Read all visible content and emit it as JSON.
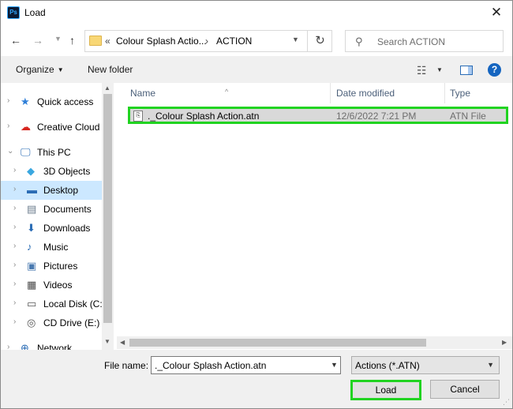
{
  "window": {
    "title": "Load",
    "app_icon_text": "Ps"
  },
  "navigation": {
    "back_icon": "arrow-left-icon",
    "forward_icon": "arrow-right-icon",
    "recent_icon": "chevron-down-icon",
    "up_icon": "arrow-up-icon",
    "address": {
      "overflow": "«",
      "segments": [
        "Colour Splash Actio...",
        "ACTION"
      ]
    },
    "search_placeholder": "Search ACTION"
  },
  "toolbar": {
    "organize_label": "Organize",
    "new_folder_label": "New folder"
  },
  "sidebar": {
    "items": [
      {
        "label": "Quick access",
        "icon": "star-icon",
        "level": 0,
        "selected": false
      },
      {
        "label": "Creative Cloud",
        "icon": "creative-cloud-icon",
        "level": 0,
        "selected": false
      },
      {
        "label": "This PC",
        "icon": "computer-icon",
        "level": 0,
        "selected": false
      },
      {
        "label": "3D Objects",
        "icon": "cube-icon",
        "level": 1,
        "selected": false
      },
      {
        "label": "Desktop",
        "icon": "desktop-icon",
        "level": 1,
        "selected": true
      },
      {
        "label": "Documents",
        "icon": "document-icon",
        "level": 1,
        "selected": false
      },
      {
        "label": "Downloads",
        "icon": "download-icon",
        "level": 1,
        "selected": false
      },
      {
        "label": "Music",
        "icon": "music-icon",
        "level": 1,
        "selected": false
      },
      {
        "label": "Pictures",
        "icon": "picture-icon",
        "level": 1,
        "selected": false
      },
      {
        "label": "Videos",
        "icon": "video-icon",
        "level": 1,
        "selected": false
      },
      {
        "label": "Local Disk (C:",
        "icon": "drive-icon",
        "level": 1,
        "selected": false
      },
      {
        "label": "CD Drive (E:)",
        "icon": "cd-icon",
        "level": 1,
        "selected": false
      },
      {
        "label": "Network",
        "icon": "network-icon",
        "level": 0,
        "selected": false
      }
    ]
  },
  "filelist": {
    "columns": [
      "Name",
      "Date modified",
      "Type"
    ],
    "files": [
      {
        "name": "._Colour Splash Action.atn",
        "date": "12/6/2022 7:21 PM",
        "type": "ATN File"
      }
    ]
  },
  "footer": {
    "filename_label": "File name:",
    "filename_value": "._Colour Splash Action.atn",
    "filetype_value": "Actions (*.ATN)",
    "load_label": "Load",
    "cancel_label": "Cancel"
  },
  "colors": {
    "highlight": "#21d321",
    "selection": "#cce8ff",
    "accent": "#1565c0"
  }
}
